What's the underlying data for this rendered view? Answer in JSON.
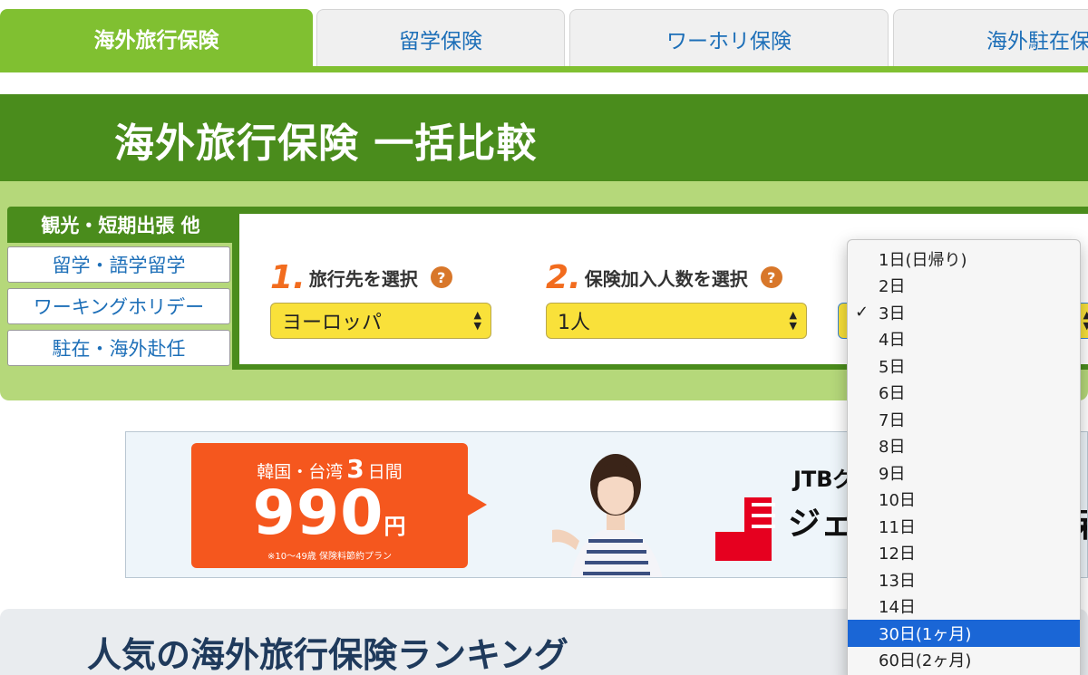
{
  "tabs": [
    {
      "label": "海外旅行保険",
      "active": true
    },
    {
      "label": "留学保険",
      "active": false
    },
    {
      "label": "ワーホリ保険",
      "active": false
    },
    {
      "label": "海外駐在保",
      "active": false
    }
  ],
  "page_title": "海外旅行保険 一括比較",
  "side_tabs": [
    {
      "label": "観光・短期出張 他",
      "active": true
    },
    {
      "label": "留学・語学留学",
      "active": false
    },
    {
      "label": "ワーキングホリデー",
      "active": false
    },
    {
      "label": "駐在・海外赴任",
      "active": false
    }
  ],
  "fields": [
    {
      "num": "1.",
      "label": "旅行先を選択",
      "value": "ヨーロッパ"
    },
    {
      "num": "2.",
      "label": "保険加入人数を選択",
      "value": "1人"
    }
  ],
  "help_glyph": "?",
  "banner": {
    "line1_a": "韓国・台湾",
    "line1_b": "3",
    "line1_c": "日間",
    "price": "990",
    "price_unit": "円",
    "note": "※10〜49歳 保険料節約プラン",
    "brand_line1": "JTBグ",
    "brand_line2": "ジェ",
    "brand_line3": "呆"
  },
  "ranking_title": "人気の海外旅行保険ランキング",
  "dropdown": {
    "options": [
      "1日(日帰り)",
      "2日",
      "3日",
      "4日",
      "5日",
      "6日",
      "7日",
      "8日",
      "9日",
      "10日",
      "11日",
      "12日",
      "13日",
      "14日",
      "30日(1ヶ月)",
      "60日(2ヶ月)"
    ],
    "selected": "3日",
    "highlighted": "30日(1ヶ月)",
    "check_glyph": "✓"
  },
  "colors": {
    "tab_active": "#80c031",
    "title_band": "#4a8c1c",
    "search_bg": "#b5d87a",
    "select_bg": "#f9e13a",
    "step_number": "#f26c1e",
    "promo": "#f5571e",
    "menu_highlight": "#1a66d6",
    "link_blue": "#1d6fb8"
  }
}
